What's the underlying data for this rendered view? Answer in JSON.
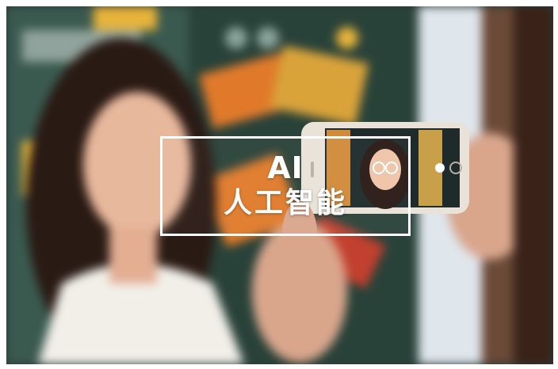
{
  "image": {
    "description_tag": "photo-ai-face-filter",
    "overlay": {
      "line1": "AI",
      "line2": "人工智能",
      "border_color": "#ffffff",
      "text_color": "#ffffff"
    },
    "palette": {
      "poster_green": "#2f4a44",
      "poster_orange": "#e07a2a",
      "poster_yellow": "#e8b43a",
      "hair": "#2a1a14",
      "skin": "#e8b89c",
      "shirt": "#f2efe9",
      "phone_body": "#e9e2d8",
      "hand_skin": "#d9a68c",
      "window_light": "#dfe6ec"
    }
  }
}
